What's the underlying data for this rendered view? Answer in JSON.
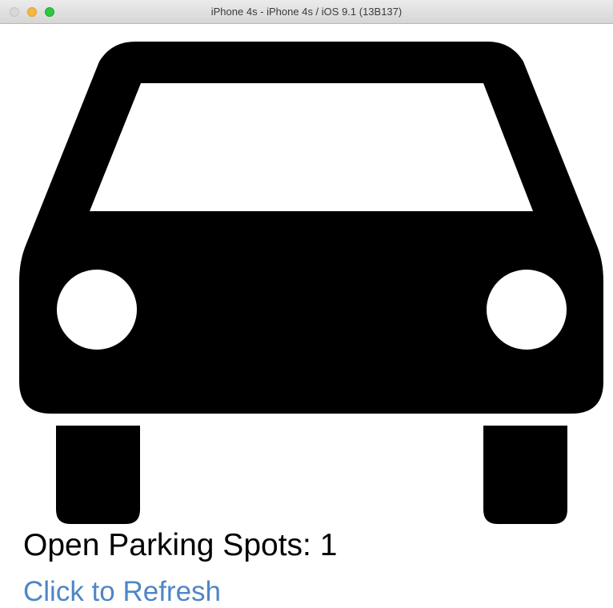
{
  "window": {
    "title": "iPhone 4s - iPhone 4s / iOS 9.1 (13B137)"
  },
  "image": {
    "icon": "car-icon"
  },
  "status": {
    "open_spots_text": "Open Parking Spots: 1"
  },
  "actions": {
    "refresh_label": "Click to Refresh"
  },
  "colors": {
    "link": "#4f86c6",
    "text": "#000000",
    "background": "#ffffff"
  }
}
